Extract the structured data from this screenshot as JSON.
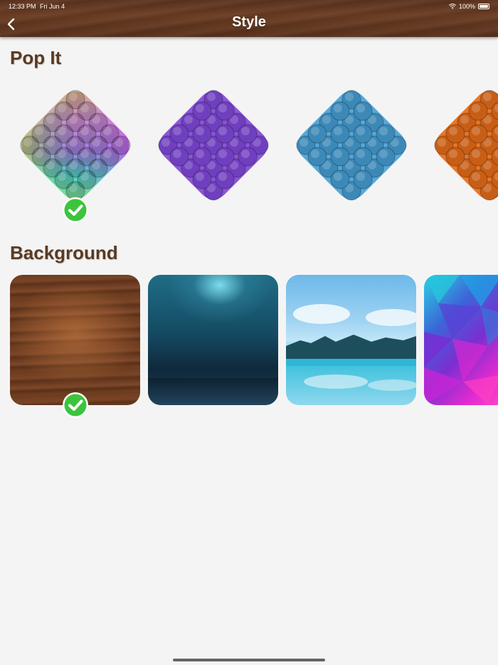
{
  "status_bar": {
    "time": "12:33 PM",
    "date": "Fri Jun 4",
    "battery": "100%"
  },
  "header": {
    "title": "Style"
  },
  "popit_section": {
    "title": "Pop It",
    "items": [
      {
        "name": "rainbow",
        "selected": true
      },
      {
        "name": "purple",
        "selected": false
      },
      {
        "name": "blue",
        "selected": false
      },
      {
        "name": "orange",
        "selected": false
      }
    ]
  },
  "background_section": {
    "title": "Background",
    "items": [
      {
        "name": "wood",
        "selected": true
      },
      {
        "name": "underwater",
        "selected": false
      },
      {
        "name": "lake",
        "selected": false
      },
      {
        "name": "polygon",
        "selected": false
      }
    ]
  },
  "colors": {
    "header": "#5e3520",
    "section_title": "#5a3a22",
    "purple": "#8a57d6",
    "blue": "#58a9d8",
    "orange": "#e8782a",
    "check": "#3cc43c"
  },
  "icons": {
    "back": "chevron-left-icon",
    "check": "checkmark-icon",
    "wifi": "wifi-icon",
    "battery": "battery-icon"
  }
}
